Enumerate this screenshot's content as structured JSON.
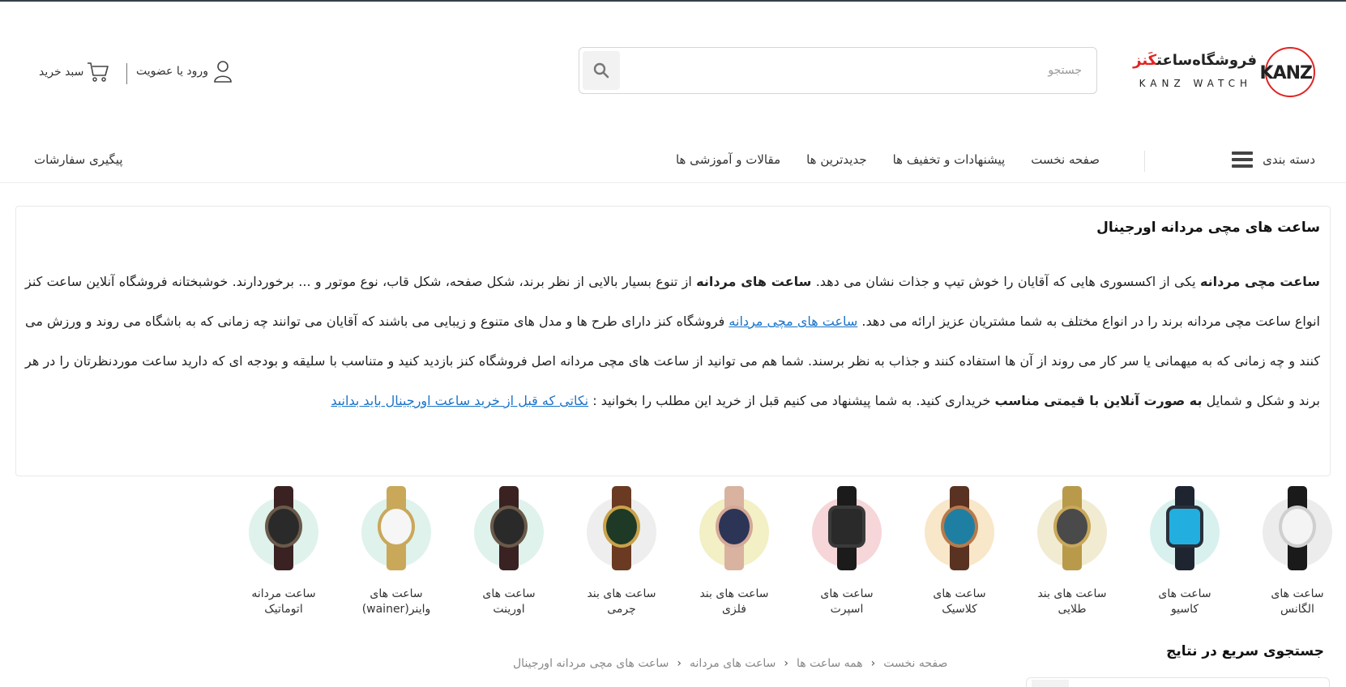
{
  "header": {
    "logo": {
      "kanz": "KANZ",
      "fa_prefix": "فروشگاه‌ساعت",
      "fa_brand": "کَنز",
      "en": "KANZ WATCH"
    },
    "search": {
      "placeholder": "جستجو",
      "icon": "search-icon"
    },
    "account_label": "ورود یا عضویت",
    "account_icon": "user-icon",
    "cart_label": "سبد خرید",
    "cart_icon": "cart-icon"
  },
  "nav": {
    "categories_label": "دسته بندی",
    "categories_icon": "hamburger-icon",
    "links": [
      "صفحه نخست",
      "پیشنهادات و تخفیف ها",
      "جدیدترین ها",
      "مقالات و آموزشی ها"
    ],
    "track_label": "پیگیری سفارشات"
  },
  "desc": {
    "title": "ساعت های مچی مردانه اورجینال",
    "s1_bold": "ساعت مچی مردانه",
    "s1": " یکی از اکسسوری هایی که آقایان را خوش تیپ و جذات نشان می دهد. ",
    "s2_bold": "ساعت های مردانه",
    "s2": " از تنوع بسیار بالایی از نظر برند، شکل صفحه، شکل قاب، نوع موتور و ... برخوردارند. خوشبختانه فروشگاه آنلاین ساعت کنز انواع ساعت مچی مردانه برند را در انواع مختلف به شما مشتریان عزیز ارائه می دهد. ",
    "link1": "ساعت های مچی مردانه",
    "s3": " فروشگاه کنز دارای طرح ها و مدل های متنوع و زیبایی می باشند که آقایان می توانند چه زمانی که به باشگاه می روند و ورزش می کنند و چه زمانی که به میهمانی یا سر کار می روند از آن ها استفاده کنند و جذاب به نظر برسند. شما هم می توانید از ساعت های مچی مردانه اصل فروشگاه کنز بازدید کنید و متناسب با سلیقه و بودجه ای که دارید ساعت موردنظرتان را در هر برند و شکل و شمایل ",
    "s4_bold": "به صورت آنلاین با قیمتی مناسب",
    "s4": " خریداری کنید.  به شما پیشنهاد می کنیم قبل از خرید این مطلب را بخوانید : ",
    "link2": "نکاتی که قبل از خرید ساعت اورجینال باید بدانید"
  },
  "categories": [
    {
      "l1": "ساعت های",
      "l2": "الگانس",
      "bg": "#ececec",
      "strap": "#1a1a1a",
      "face": "#f4f4f4",
      "rim": "#cfcfcf"
    },
    {
      "l1": "ساعت های",
      "l2": "کاسیو",
      "bg": "#d8f1ee",
      "strap": "#1e2530",
      "face": "#23aee0",
      "rim": "#2a2f3a"
    },
    {
      "l1": "ساعت های بند",
      "l2": "طلایی",
      "bg": "#f1ebd2",
      "strap": "#b89a4a",
      "face": "#4a4a4a",
      "rim": "#c8a85a"
    },
    {
      "l1": "ساعت های",
      "l2": "کلاسیک",
      "bg": "#f8e7c8",
      "strap": "#5a3222",
      "face": "#1f7fa3",
      "rim": "#b87a4a"
    },
    {
      "l1": "ساعت های",
      "l2": "اسپرت",
      "bg": "#f6d6d8",
      "strap": "#1b1b1b",
      "face": "#2a2a2a",
      "rim": "#3a3a3a"
    },
    {
      "l1": "ساعت های بند",
      "l2": "فلزی",
      "bg": "#f2f0c4",
      "strap": "#d9b3a0",
      "face": "#2d3556",
      "rim": "#d4a898"
    },
    {
      "l1": "ساعت های بند",
      "l2": "چرمی",
      "bg": "#eeeeee",
      "strap": "#6a3a22",
      "face": "#1e3a26",
      "rim": "#c9a24a"
    },
    {
      "l1": "ساعت های",
      "l2": "اورینت",
      "bg": "#dff2ec",
      "strap": "#3a2222",
      "face": "#2a2a2a",
      "rim": "#6a5a4a"
    },
    {
      "l1": "ساعت های",
      "l2": "واینر(wainer)",
      "bg": "#dff2ec",
      "strap": "#c9a85a",
      "face": "#f6f6f6",
      "rim": "#c9a85a"
    },
    {
      "l1": "ساعت مردانه",
      "l2": "اتوماتیک",
      "bg": "#dff2ec",
      "strap": "#3a2222",
      "face": "#2a2a2a",
      "rim": "#6a5a4a"
    }
  ],
  "breadcrumb": [
    "صفحه نخست",
    "همه ساعت ها",
    "ساعت های مردانه",
    "ساعت های مچی مردانه اورجینال"
  ],
  "quick_search_title": "جستجوی سریع در نتایج"
}
